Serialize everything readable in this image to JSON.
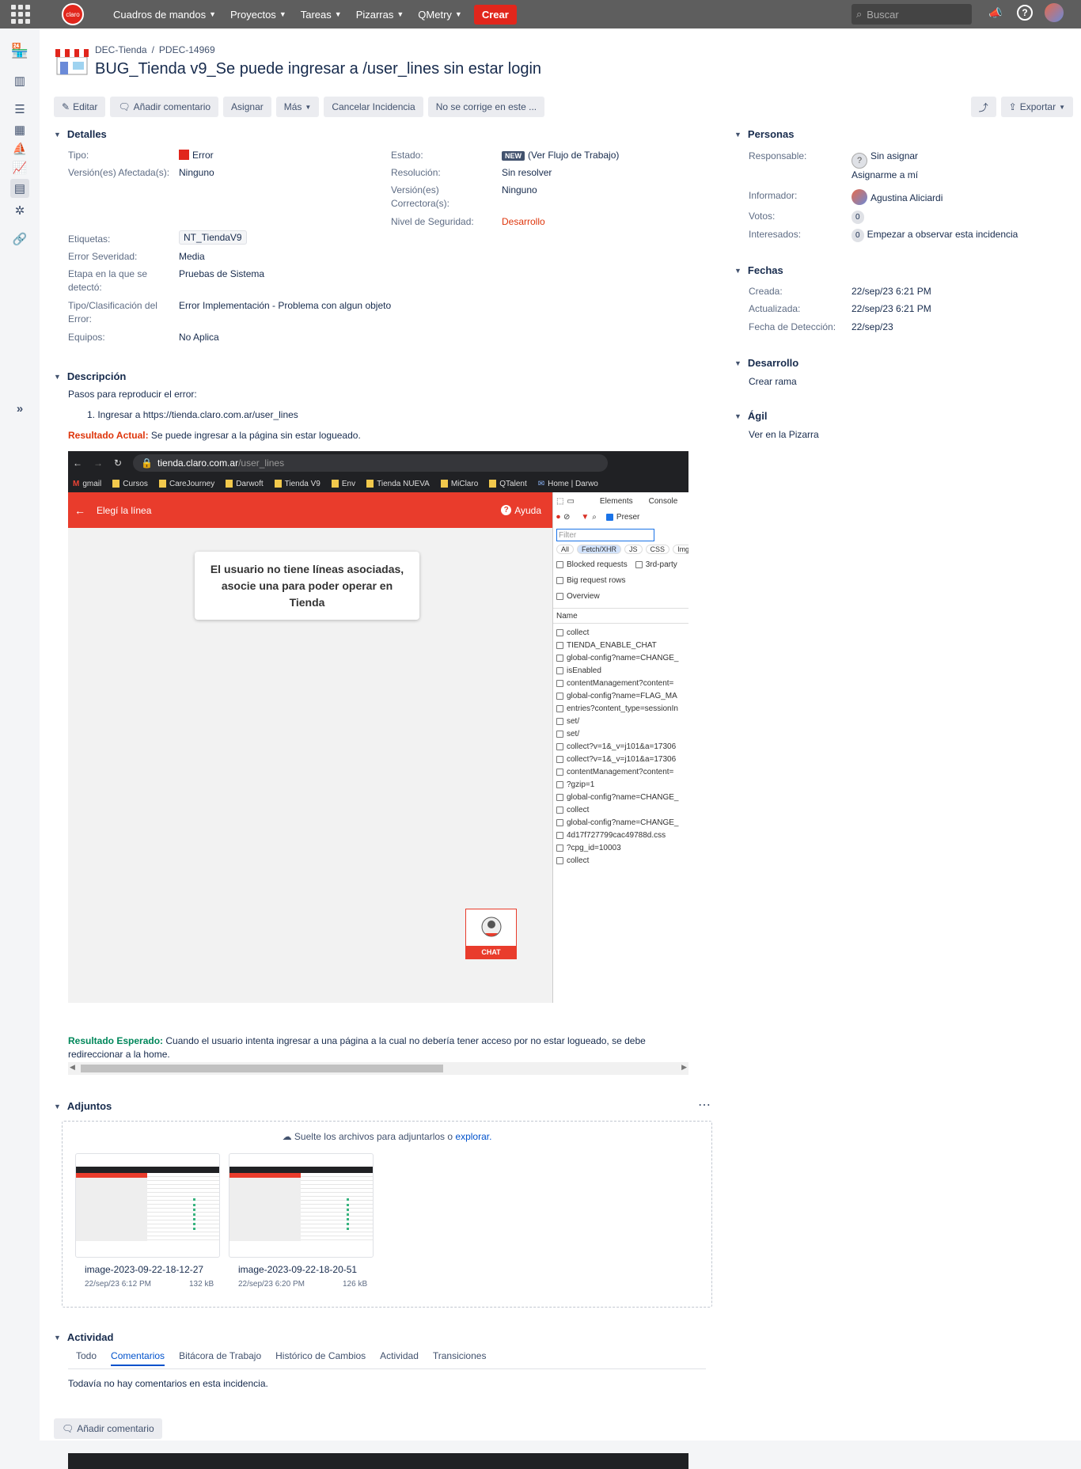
{
  "topnav": {
    "items": [
      "Cuadros de mandos",
      "Proyectos",
      "Tareas",
      "Pizarras",
      "QMetry"
    ],
    "create_label": "Crear",
    "search_placeholder": "Buscar",
    "logo_text": "claro"
  },
  "breadcrumb": {
    "project": "DEC-Tienda",
    "key": "PDEC-14969"
  },
  "issue_title": "BUG_Tienda v9_Se puede ingresar a /user_lines sin estar login",
  "toolbar": {
    "edit": "Editar",
    "comment": "Añadir comentario",
    "assign": "Asignar",
    "more": "Más",
    "cancel": "Cancelar Incidencia",
    "wontfix": "No se corrige en este ...",
    "export": "Exportar"
  },
  "details": {
    "heading": "Detalles",
    "tipo_label": "Tipo:",
    "tipo_value": "Error",
    "version_label": "Versión(es) Afectada(s):",
    "version_value": "Ninguno",
    "estado_label": "Estado:",
    "estado_badge": "NEW",
    "estado_value": "(Ver Flujo de Trabajo)",
    "resolucion_label": "Resolución:",
    "resolucion_value": "Sin resolver",
    "correctora_label": "Versión(es) Correctora(s):",
    "correctora_value": "Ninguno",
    "seguridad_label": "Nivel de Seguridad:",
    "seguridad_value": "Desarrollo",
    "etiquetas_label": "Etiquetas:",
    "etiquetas_value": "NT_TiendaV9",
    "severidad_label": "Error Severidad:",
    "severidad_value": "Media",
    "etapa_label": "Etapa en la que se detectó:",
    "etapa_value": "Pruebas de Sistema",
    "clasif_label": "Tipo/Clasificación del Error:",
    "clasif_value": "Error Implementación - Problema con algun objeto",
    "equipos_label": "Equipos:",
    "equipos_value": "No Aplica"
  },
  "description": {
    "heading": "Descripción",
    "steps_intro": "Pasos para reproducir el error:",
    "step1": "1. Ingresar a https://tienda.claro.com.ar/user_lines",
    "actual_label": "Resultado Actual:",
    "actual_text": "Se puede ingresar a la página sin estar logueado.",
    "expected_label": "Resultado Esperado:",
    "expected_text": "Cuando el usuario intenta ingresar a una página a la cual no debería tener acceso por no estar logueado, se debe redireccionar a la home."
  },
  "screenshot": {
    "url_host": "tienda.claro.com.ar",
    "url_path": "/user_lines",
    "bookmarks": [
      "gmail",
      "Cursos",
      "CareJourney",
      "Darwoft",
      "Tienda V9",
      "Env",
      "Tienda NUEVA",
      "MiClaro",
      "QTalent",
      "Home | Darwo"
    ],
    "app_title": "Elegí la línea",
    "help": "Ayuda",
    "empty_msg": "El usuario no tiene líneas asociadas, asocie una para poder operar en Tienda",
    "chat": "CHAT",
    "dev_tabs": [
      "Elements",
      "Console"
    ],
    "preserve": "Preser",
    "filter_placeholder": "Filter",
    "filter_pills": [
      "All",
      "Fetch/XHR",
      "JS",
      "CSS",
      "Img"
    ],
    "blocked": "Blocked requests",
    "thirdparty": "3rd-party",
    "bigrows": "Big request rows",
    "overview": "Overview",
    "name_col": "Name",
    "requests": [
      "collect",
      "TIENDA_ENABLE_CHAT",
      "global-config?name=CHANGE_",
      "isEnabled",
      "contentManagement?content=",
      "global-config?name=FLAG_MA",
      "entries?content_type=sessionIn",
      "set/",
      "set/",
      "collect?v=1&_v=j101&a=17306",
      "collect?v=1&_v=j101&a=17306",
      "contentManagement?content=",
      "?gzip=1",
      "global-config?name=CHANGE_",
      "collect",
      "global-config?name=CHANGE_",
      "4d17f727799cac49788d.css",
      "?cpg_id=10003",
      "collect"
    ]
  },
  "attachments": {
    "heading": "Adjuntos",
    "drop_text": "Suelte los archivos para adjuntarlos o",
    "drop_link": "explorar.",
    "files": [
      {
        "name": "image-2023-09-22-18-12-27",
        "date": "22/sep/23 6:12 PM",
        "size": "132 kB"
      },
      {
        "name": "image-2023-09-22-18-20-51",
        "date": "22/sep/23 6:20 PM",
        "size": "126 kB"
      }
    ]
  },
  "activity": {
    "heading": "Actividad",
    "tabs": [
      "Todo",
      "Comentarios",
      "Bitácora de Trabajo",
      "Histórico de Cambios",
      "Actividad",
      "Transiciones"
    ],
    "empty": "Todavía no hay comentarios en esta incidencia.",
    "add_comment": "Añadir comentario"
  },
  "people": {
    "heading": "Personas",
    "responsable_label": "Responsable:",
    "responsable_value": "Sin asignar",
    "assign_me": "Asignarme a mí",
    "informador_label": "Informador:",
    "informador_value": "Agustina Aliciardi",
    "votos_label": "Votos:",
    "votos_value": "0",
    "interesados_label": "Interesados:",
    "interesados_count": "0",
    "watch": "Empezar a observar esta incidencia"
  },
  "dates": {
    "heading": "Fechas",
    "creada_label": "Creada:",
    "creada_value": "22/sep/23 6:21 PM",
    "actualizada_label": "Actualizada:",
    "actualizada_value": "22/sep/23 6:21 PM",
    "deteccion_label": "Fecha de Detección:",
    "deteccion_value": "22/sep/23"
  },
  "development": {
    "heading": "Desarrollo",
    "branch": "Crear rama"
  },
  "agile": {
    "heading": "Ágil",
    "board": "Ver en la Pizarra"
  },
  "colors": {
    "claro_red": "#e1261c",
    "link": "#0052cc",
    "topbar": "#5e5e5e"
  }
}
